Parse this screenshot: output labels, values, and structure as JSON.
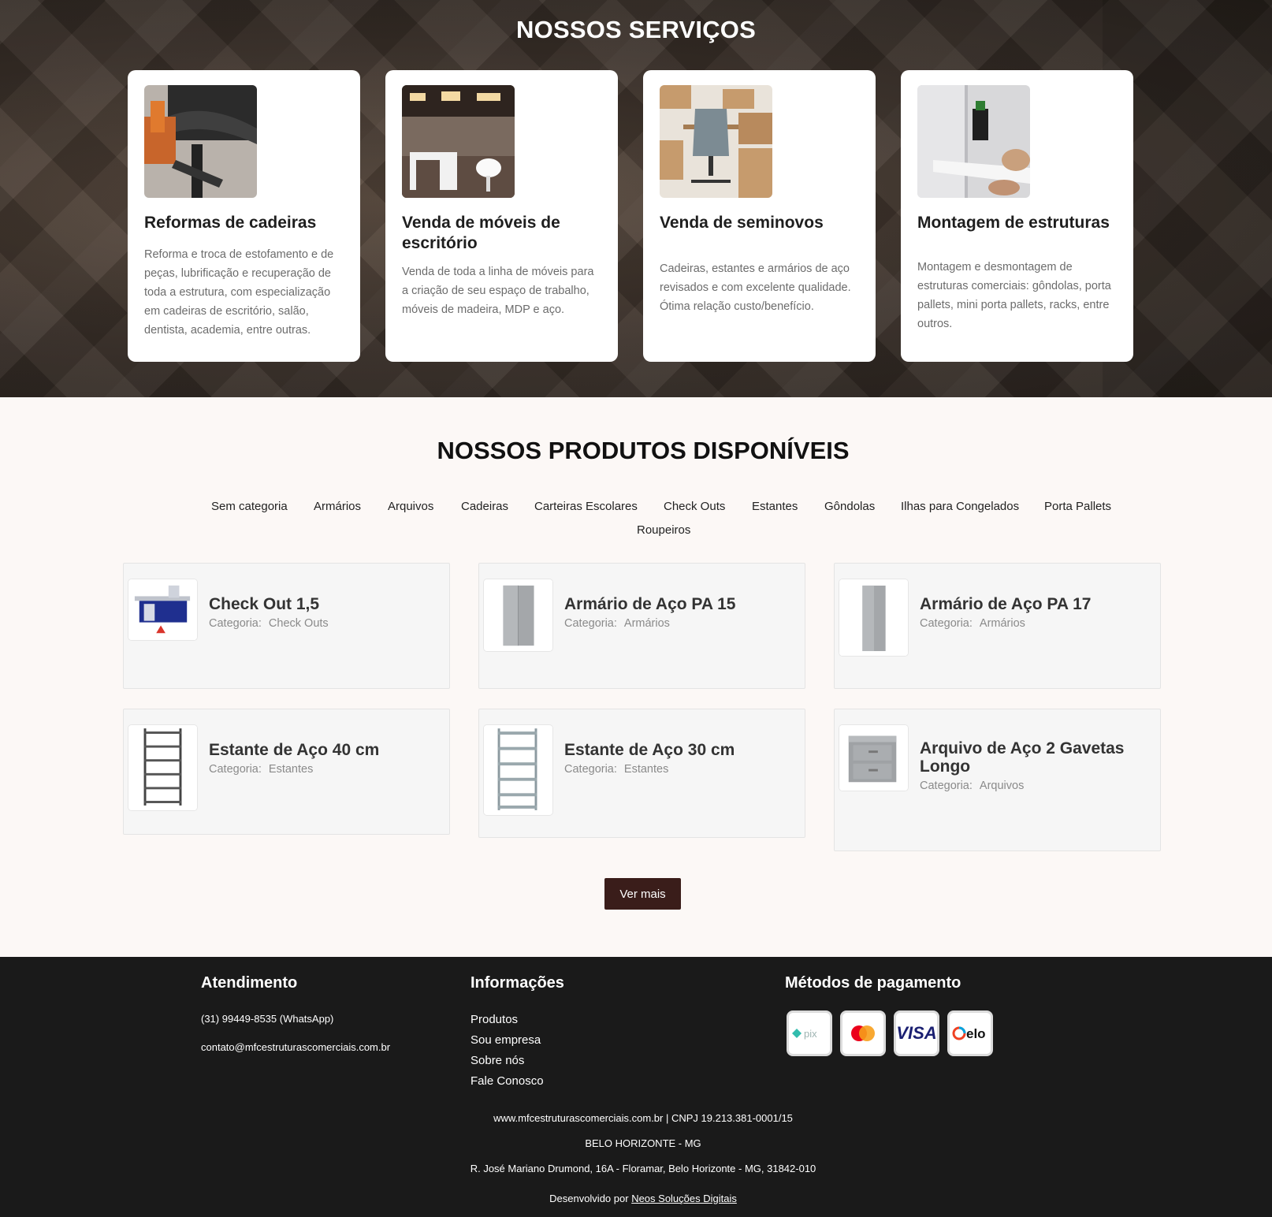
{
  "services": {
    "title": "NOSSOS SERVIÇOS",
    "cards": [
      {
        "title": "Reformas de cadeiras",
        "description": "Reforma e troca de estofamento e de peças, lubrificação e recuperação de toda a estrutura, com especialização em cadeiras de escritório, salão, dentista, academia, entre outras."
      },
      {
        "title": "Venda de móveis de escritório",
        "description": "Venda de toda a linha de móveis para a criação de seu espaço de trabalho, móveis de madeira, MDP e aço."
      },
      {
        "title": "Venda de seminovos",
        "description": "Cadeiras, estantes e armários de aço revisados e com excelente qualidade. Ótima relação custo/benefício."
      },
      {
        "title": "Montagem de estruturas",
        "description": "Montagem e desmontagem de estruturas comerciais: gôndolas, porta pallets, mini porta pallets, racks, entre outros."
      }
    ]
  },
  "products": {
    "title": "NOSSOS PRODUTOS DISPONÍVEIS",
    "categories": [
      "Sem categoria",
      "Armários",
      "Arquivos",
      "Cadeiras",
      "Carteiras Escolares",
      "Check Outs",
      "Estantes",
      "Gôndolas",
      "Ilhas para Congelados",
      "Porta Pallets",
      "Roupeiros"
    ],
    "category_label": "Categoria:",
    "items": [
      {
        "name": "Check Out 1,5",
        "category": "Check Outs"
      },
      {
        "name": "Armário de Aço PA 15",
        "category": "Armários"
      },
      {
        "name": "Armário de Aço PA 17",
        "category": "Armários"
      },
      {
        "name": "Estante de Aço 40 cm",
        "category": "Estantes"
      },
      {
        "name": "Estante de Aço 30 cm",
        "category": "Estantes"
      },
      {
        "name": "Arquivo de Aço 2 Gavetas Longo",
        "category": "Arquivos"
      }
    ],
    "more_button": "Ver mais"
  },
  "footer": {
    "atendimento": {
      "title": "Atendimento",
      "phone": "(31) 99449-8535 (WhatsApp)",
      "email": "contato@mfcestruturascomerciais.com.br"
    },
    "informacoes": {
      "title": "Informações",
      "links": [
        "Produtos",
        "Sou empresa",
        "Sobre nós",
        "Fale Conosco"
      ]
    },
    "pagamento": {
      "title": "Métodos de pagamento",
      "methods": [
        "pix",
        "mastercard",
        "VISA",
        "elo"
      ]
    },
    "site_line": "www.mfcestruturascomerciais.com.br | CNPJ 19.213.381-0001/15",
    "city": "BELO HORIZONTE - MG",
    "address": "R. José Mariano Drumond, 16A - Floramar, Belo Horizonte - MG, 31842-010",
    "dev_prefix": "Desenvolvido por",
    "dev_name": "Neos Soluções Digitais"
  },
  "colors": {
    "accent": "#3a1d1a",
    "footer_bg": "#1a1a1a",
    "section_bg": "#fcf8f6"
  }
}
